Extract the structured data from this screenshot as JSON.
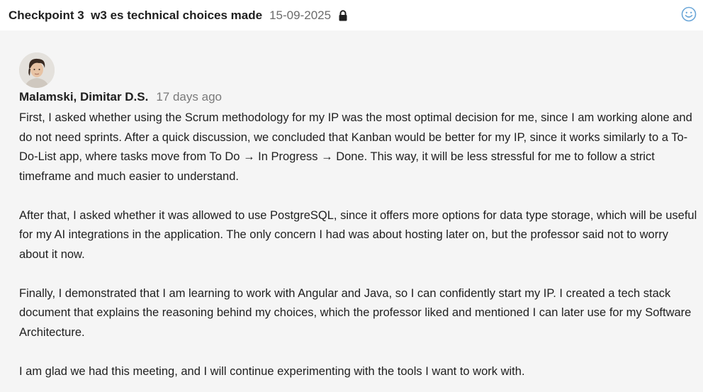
{
  "header": {
    "title": "Checkpoint 3  w3 es technical choices made",
    "date": "15-09-2025",
    "lock_icon": "lock-icon",
    "reaction_icon": "smiley-icon",
    "accent_color": "#6aa6d8"
  },
  "post": {
    "author": "Malamski, Dimitar D.S.",
    "time_ago": "17 days ago",
    "paragraphs": [
      "First, I asked whether using the Scrum methodology for my IP was the most optimal decision for me, since I am working alone and do not need sprints. After a quick discussion, we concluded that Kanban would be better for my IP, since it works similarly to a To-Do-List app, where tasks move from To Do → In Progress → Done. This way, it will be less stressful for me to follow a strict timeframe and much easier to understand.",
      "After that, I asked whether it was allowed to use PostgreSQL, since it offers more options for data type storage, which will be useful for my AI integrations in the application. The only concern I had was about hosting later on, but the professor said not to worry about it now.",
      "Finally, I demonstrated that I am learning to work with Angular and Java, so I can confidently start my IP. I created a tech stack document that explains the reasoning behind my choices, which the professor liked and mentioned I can later use for my Software Architecture.",
      "I am glad we had this meeting, and I will continue experimenting with the tools I want to work with."
    ]
  }
}
